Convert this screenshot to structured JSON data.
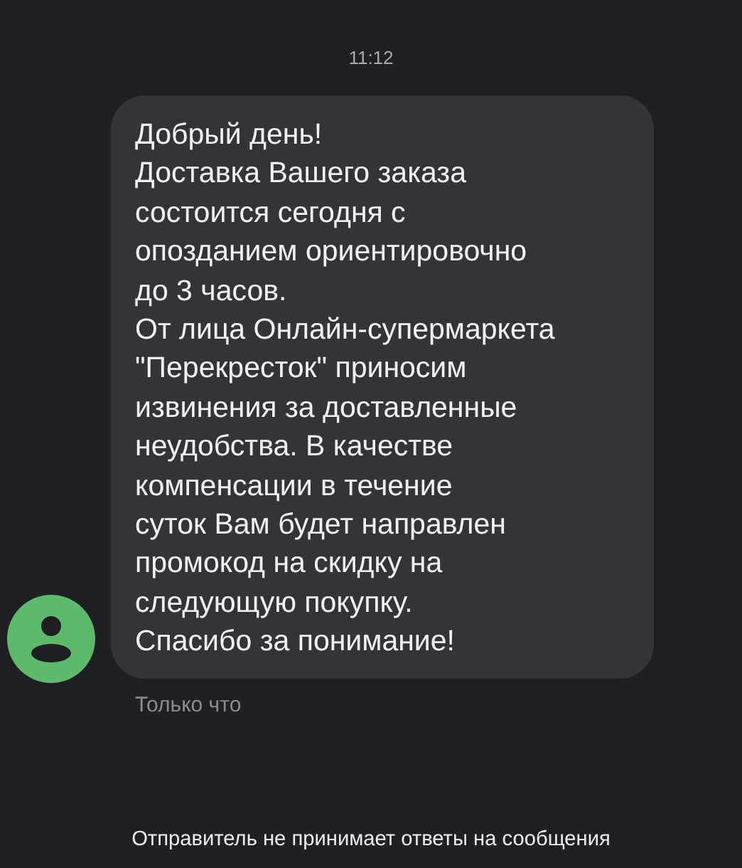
{
  "time": "11:12",
  "message": {
    "text": "Добрый день!\nДоставка Вашего заказа\nсостоится сегодня с\nопозданием ориентировочно\nдо 3 часов.\nОт лица Онлайн-супермаркета\n\"Перекресток\" приносим\nизвинения за доставленные\nнеудобства. В качестве\nкомпенсации в течение\nсуток Вам будет направлен\nпромокод на скидку на\nследующую покупку.\nСпасибо за понимание!",
    "status": "Только что"
  },
  "footer": "Отправитель не принимает ответы на сообщения"
}
